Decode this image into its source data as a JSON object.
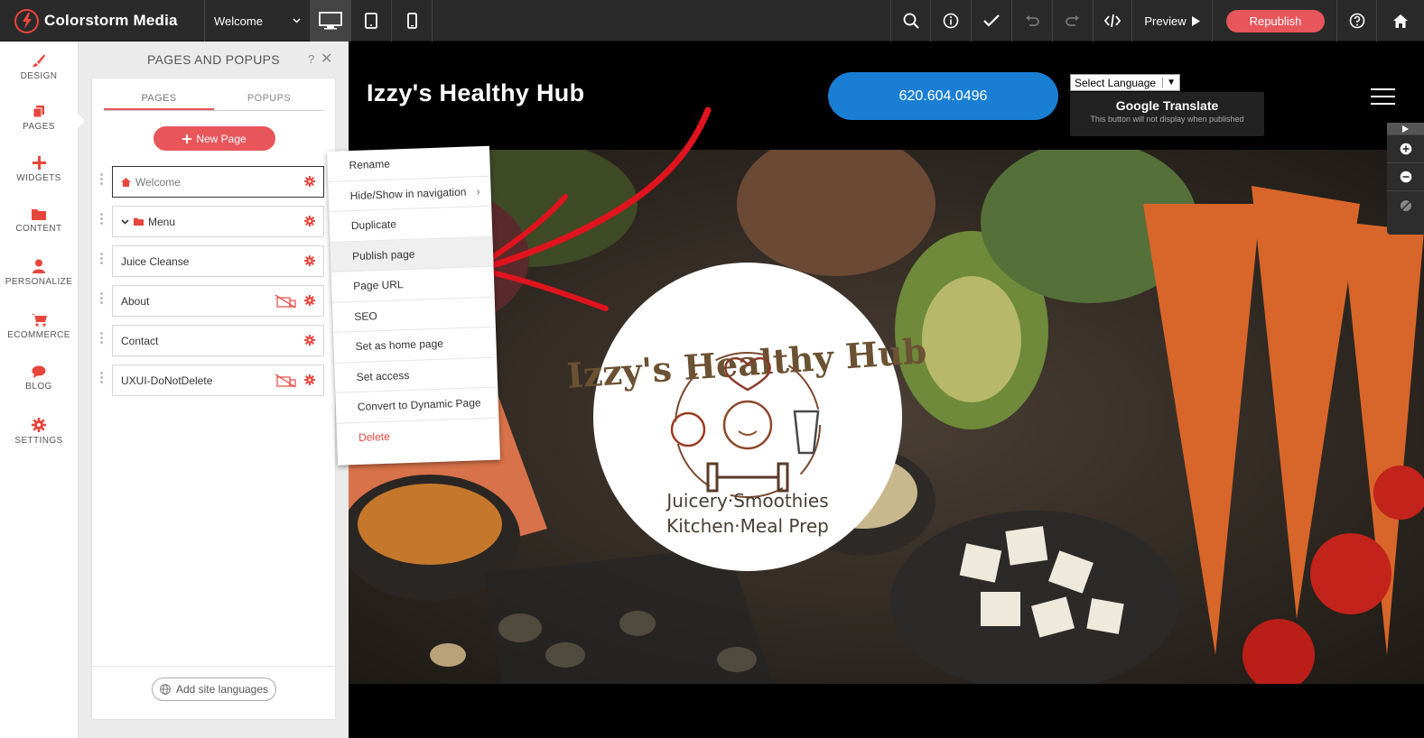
{
  "app": {
    "brand": "Colorstorm Media",
    "page_select": "Welcome",
    "preview_label": "Preview",
    "republish_label": "Republish"
  },
  "rail": {
    "items": [
      {
        "label": "DESIGN",
        "icon": "brush-icon"
      },
      {
        "label": "PAGES",
        "icon": "pages-icon"
      },
      {
        "label": "WIDGETS",
        "icon": "plus-icon"
      },
      {
        "label": "CONTENT",
        "icon": "folder-icon"
      },
      {
        "label": "PERSONALIZE",
        "icon": "person-icon"
      },
      {
        "label": "ECOMMERCE",
        "icon": "cart-icon"
      },
      {
        "label": "BLOG",
        "icon": "chat-bubble-icon"
      },
      {
        "label": "SETTINGS",
        "icon": "gear-icon"
      }
    ]
  },
  "panel": {
    "title": "PAGES AND POPUPS",
    "help": "?",
    "tabs": [
      "PAGES",
      "POPUPS"
    ],
    "new_page_label": "New Page",
    "pages": [
      {
        "name": "Welcome",
        "home": true
      },
      {
        "name": "Menu",
        "folder": true
      },
      {
        "name": "Juice Cleanse"
      },
      {
        "name": "About",
        "hidden": true
      },
      {
        "name": "Contact"
      },
      {
        "name": "UXUI-DoNotDelete",
        "hidden": true
      }
    ],
    "add_languages_label": "Add site languages"
  },
  "site": {
    "title": "Izzy's Healthy Hub",
    "phone": "620.604.0496",
    "language_select": "Select Language",
    "google_translate": "Google Translate",
    "google_translate_note": "This button will not display when published",
    "logo": {
      "arc_text": "Izzy's Healthy Hub",
      "line1": "Juicery·Smoothies",
      "line2": "Kitchen·Meal Prep"
    }
  },
  "context_menu": {
    "items": [
      "Rename",
      "Hide/Show in navigation",
      "Duplicate",
      "Publish page",
      "Page URL",
      "SEO",
      "Set as home page",
      "Set access",
      "Convert to Dynamic Page",
      "Delete"
    ],
    "highlighted": "Publish page"
  },
  "colors": {
    "accent": "#e8555b",
    "topbar": "#2a2a2a",
    "phone_button": "#1a7fd4",
    "annotation_arrow": "#e0141e"
  }
}
